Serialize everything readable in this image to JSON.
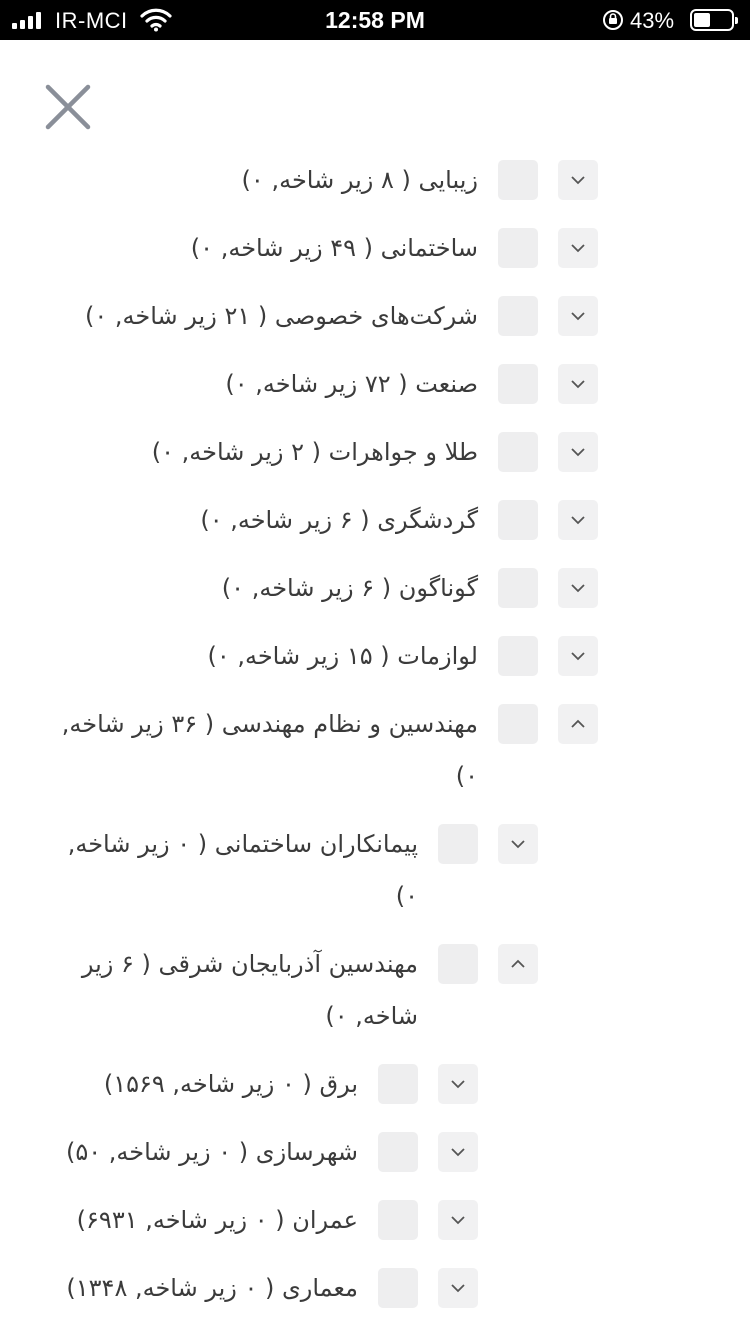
{
  "status_bar": {
    "carrier": "IR-MCI",
    "time": "12:58 PM",
    "battery": "43%",
    "battery_level": 0.43
  },
  "close_icon": "close-icon",
  "tree": {
    "items": [
      {
        "label": "زیبایی ( ۸ زیر شاخه, ۰)",
        "expanded": false,
        "level": 0
      },
      {
        "label": "ساختمانی ( ۴۹ زیر شاخه, ۰)",
        "expanded": false,
        "level": 0
      },
      {
        "label": "شرکت‌های خصوصی ( ۲۱ زیر شاخه, ۰)",
        "expanded": false,
        "level": 0
      },
      {
        "label": "صنعت ( ۷۲ زیر شاخه, ۰)",
        "expanded": false,
        "level": 0
      },
      {
        "label": "طلا و جواهرات ( ۲ زیر شاخه, ۰)",
        "expanded": false,
        "level": 0
      },
      {
        "label": "گردشگری ( ۶ زیر شاخه, ۰)",
        "expanded": false,
        "level": 0
      },
      {
        "label": "گوناگون ( ۶ زیر شاخه, ۰)",
        "expanded": false,
        "level": 0
      },
      {
        "label": "لوازمات ( ۱۵ زیر شاخه, ۰)",
        "expanded": false,
        "level": 0
      },
      {
        "label": "مهندسین و نظام مهندسی ( ۳۶ زیر شاخه, ۰)",
        "expanded": true,
        "level": 0
      },
      {
        "label": "پیمانکاران ساختمانی ( ۰ زیر شاخه, ۰)",
        "expanded": false,
        "level": 1
      },
      {
        "label": "مهندسین آذربایجان شرقی ( ۶ زیر شاخه, ۰)",
        "expanded": true,
        "level": 1
      },
      {
        "label": "برق ( ۰ زیر شاخه, ۱۵۶۹)",
        "expanded": false,
        "level": 2
      },
      {
        "label": "شهرسازی ( ۰ زیر شاخه, ۵۰)",
        "expanded": false,
        "level": 2
      },
      {
        "label": "عمران ( ۰ زیر شاخه, ۶۹۳۱)",
        "expanded": false,
        "level": 2
      },
      {
        "label": "معماری ( ۰ زیر شاخه, ۱۳۴۸)",
        "expanded": false,
        "level": 2
      }
    ]
  }
}
